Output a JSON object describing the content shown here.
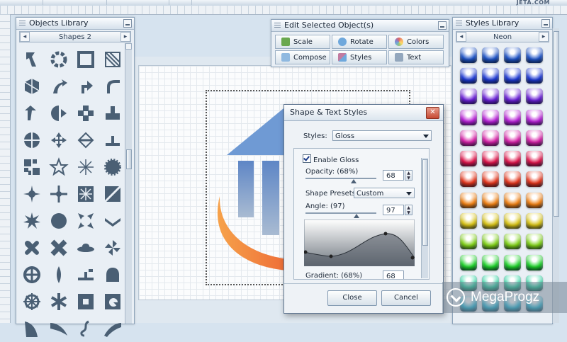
{
  "brand": "JETA.COM",
  "objects_library": {
    "title": "Objects Library",
    "category": "Shapes 2",
    "prev_icon": "◂",
    "next_icon": "▸",
    "shapes": [
      "hook-shape",
      "gear-ring-shape",
      "square-frame-shape",
      "hatched-triangle-shape",
      "cube-shape",
      "arrow-curve-shape",
      "bent-arrow-shape",
      "curve-corner-shape",
      "arrow-left-shape",
      "half-circle-arrows-shape",
      "cross-blocks-shape",
      "plug-shape",
      "split-circle-shape",
      "quad-arrows-shape",
      "diamond-arrows-shape",
      "pedestal-shape",
      "quilt-shape",
      "star-shape",
      "asterisk-shape",
      "sunburst-shape",
      "spike-star-shape",
      "plus-burst-shape",
      "snowflake-box-shape",
      "diagonal-split-shape",
      "starburst-shape",
      "circle-shape",
      "arrows-in-shape",
      "chevron-shape",
      "four-petal-shape",
      "x-cross-shape",
      "ufo-shape",
      "pinwheel-shape",
      "target-cross-shape",
      "spindle-shape",
      "step-arrow-shape",
      "bell-shape",
      "sun-gear-shape",
      "asterisk-bold-shape",
      "notched-square-shape",
      "dial-shape",
      "sail-shape",
      "crescent-blade-shape",
      "swirl-shape",
      "wedge-arc-shape"
    ]
  },
  "edit_panel": {
    "title": "Edit Selected Object(s)",
    "buttons": [
      {
        "label": "Scale",
        "color": "#6aa84f"
      },
      {
        "label": "Rotate",
        "color": "#6fa8dc"
      },
      {
        "label": "Colors",
        "color": "#e06666"
      },
      {
        "label": "Compose",
        "color": "#8fb9e0"
      },
      {
        "label": "Styles",
        "color": "#c27ba0"
      },
      {
        "label": "Text",
        "color": "#93a7bd"
      }
    ]
  },
  "styles_library": {
    "title": "Styles Library",
    "category": "Neon",
    "prev_icon": "◂",
    "next_icon": "▸",
    "rows": [
      "#1e54c8",
      "#1f3bd6",
      "#6a1fd8",
      "#b81fd8",
      "#d81fa8",
      "#e0134a",
      "#e6341a",
      "#f07f10",
      "#d9c414",
      "#7fd115",
      "#1fd42b",
      "#15d39a",
      "#14b8d9"
    ]
  },
  "dialog": {
    "title": "Shape & Text Styles",
    "close_icon": "✕",
    "styles_label": "Styles:",
    "styles_value": "Gloss",
    "enable_gloss_label": "Enable Gloss",
    "opacity_label": "Opacity: (68%)",
    "opacity_value": "68",
    "opacity_fraction": 0.68,
    "presets_label": "Shape Presets:",
    "presets_value": "Custom",
    "angle_label": "Angle: (97)",
    "angle_value": "97",
    "angle_fraction": 0.72,
    "gradient_label": "Gradient: (68%)",
    "gradient_value": "68",
    "close_button": "Close",
    "cancel_button": "Cancel"
  },
  "watermark": {
    "text": "MegaProgz"
  }
}
